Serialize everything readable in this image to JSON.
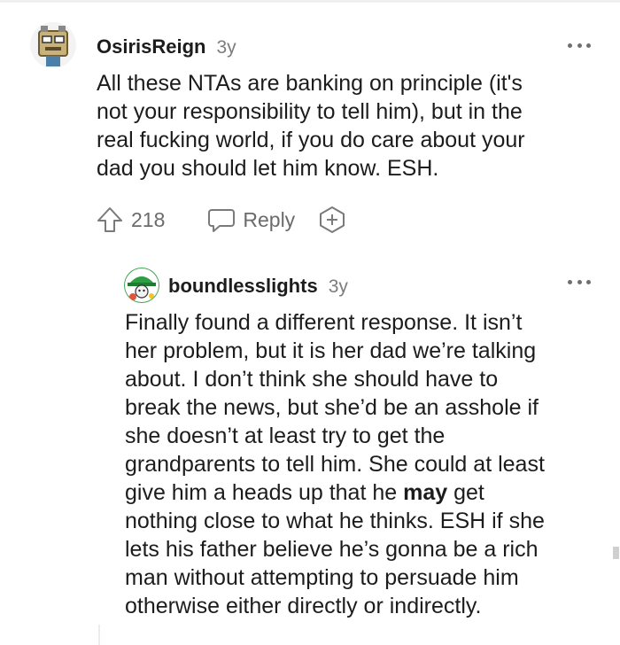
{
  "comments": [
    {
      "author": "OsirisReign",
      "age": "3y",
      "avatar_icon": "robot-box-avatar",
      "body_lines": [
        "All these NTAs are banking on principle (it's",
        "not your responsibility to tell him), but in the",
        "real fucking world, if you do care about your",
        "dad you should let him know. ESH."
      ],
      "votes": "218",
      "reply_label": "Reply",
      "more_icon": "more-dots-icon"
    },
    {
      "author": "boundlesslights",
      "age": "3y",
      "avatar_icon": "green-hat-avatar",
      "body_lines": [
        "Finally found a different response. It isn’t",
        "her problem, but it is her dad we’re talking",
        "about. I don’t think she should have to",
        "break the news, but she’d be an asshole if",
        "she doesn’t at least try to get the",
        "grandparents to tell him. She could at least",
        "give him a heads up that he ",
        "may",
        " get",
        "nothing close to what he thinks. ESH if she",
        "lets his father believe he’s gonna be a rich",
        "man without attempting to persuade him",
        "otherwise either directly or indirectly."
      ],
      "more_icon": "more-dots-icon"
    }
  ],
  "colors": {
    "text": "#1c1c1c",
    "muted": "#7c7c7c",
    "action": "#6b6b6b",
    "avatar1_bg": "#e9e9e9",
    "avatar2_bg": "#46c15a"
  }
}
